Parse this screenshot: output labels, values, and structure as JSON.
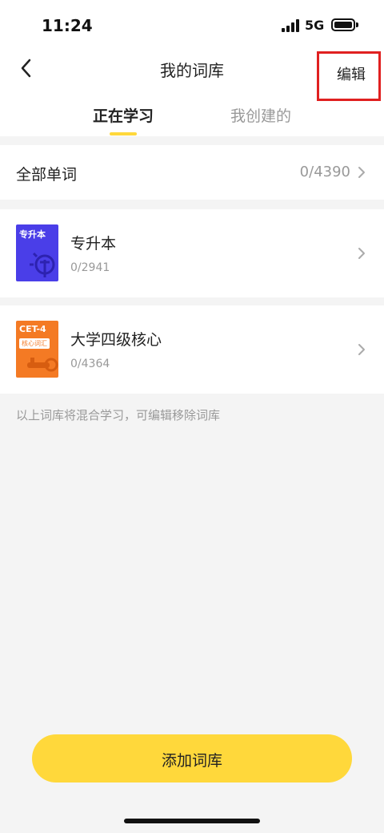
{
  "status_bar": {
    "time": "11:24",
    "network": "5G"
  },
  "header": {
    "title": "我的词库",
    "edit_label": "编辑",
    "tabs": [
      {
        "label": "正在学习",
        "active": true
      },
      {
        "label": "我创建的",
        "active": false
      }
    ]
  },
  "all_words": {
    "label": "全部单词",
    "count": "0/4390"
  },
  "books": [
    {
      "name": "专升本",
      "progress": "0/2941",
      "cover_text": "专升本",
      "cover_color": "#4a3ee8"
    },
    {
      "name": "大学四级核心",
      "progress": "0/4364",
      "cover_text": "CET-4",
      "cover_tag": "核心词汇",
      "cover_color": "#f47a24"
    }
  ],
  "hint": "以上词库将混合学习，可编辑移除词库",
  "add_button": {
    "label": "添加词库"
  },
  "colors": {
    "accent": "#ffd83b",
    "highlight_border": "#e02020"
  }
}
